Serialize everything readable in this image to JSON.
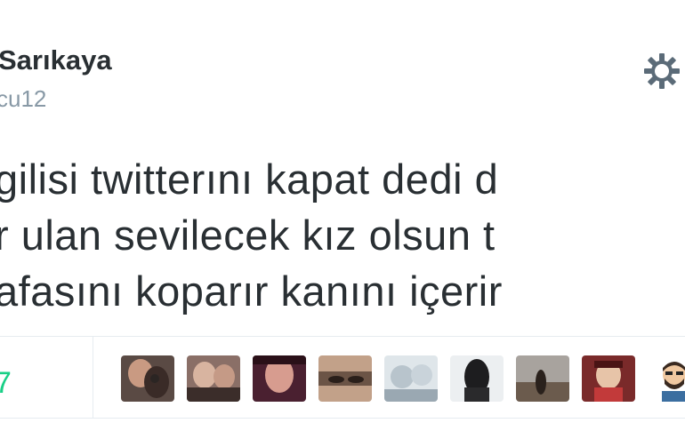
{
  "profile": {
    "display_name": "Sarıkaya",
    "handle": "cu12"
  },
  "icons": {
    "settings": "gear-icon"
  },
  "tweet": {
    "lines": [
      "gilisi twitterını kapat dedi d",
      "r ulan sevilecek kız olsun t",
      "afasını koparır kanını içerir"
    ]
  },
  "stats": {
    "count": "7"
  },
  "likers": [
    {
      "name": "avatar-1"
    },
    {
      "name": "avatar-2"
    },
    {
      "name": "avatar-3"
    },
    {
      "name": "avatar-4"
    },
    {
      "name": "avatar-5"
    },
    {
      "name": "avatar-6"
    },
    {
      "name": "avatar-7"
    },
    {
      "name": "avatar-8"
    },
    {
      "name": "avatar-9"
    }
  ],
  "colors": {
    "text": "#292f33",
    "muted": "#8899a6",
    "count_green": "#19cf86",
    "divider": "#e6ecf0"
  }
}
